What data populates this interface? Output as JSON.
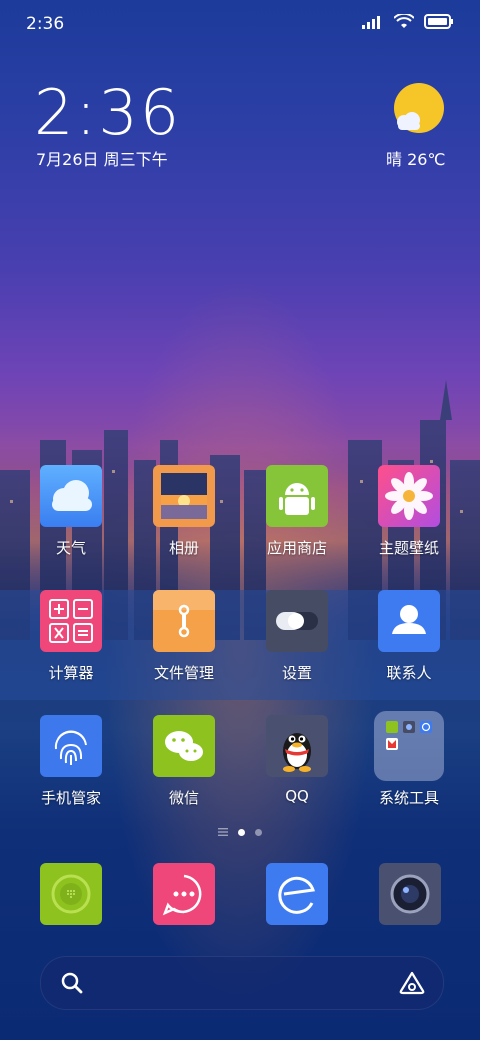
{
  "status_bar": {
    "time": "2:36"
  },
  "clock_widget": {
    "time": "2:36",
    "date": "7月26日 周三下午"
  },
  "weather_widget": {
    "text": "晴 26℃"
  },
  "apps": [
    {
      "label": "天气",
      "icon": "weather-cloud-icon"
    },
    {
      "label": "相册",
      "icon": "gallery-icon"
    },
    {
      "label": "应用商店",
      "icon": "android-store-icon"
    },
    {
      "label": "主题壁纸",
      "icon": "theme-flower-icon"
    },
    {
      "label": "计算器",
      "icon": "calculator-icon"
    },
    {
      "label": "文件管理",
      "icon": "file-manager-icon"
    },
    {
      "label": "设置",
      "icon": "settings-toggle-icon"
    },
    {
      "label": "联系人",
      "icon": "contacts-icon"
    },
    {
      "label": "手机管家",
      "icon": "fingerprint-icon"
    },
    {
      "label": "微信",
      "icon": "wechat-icon"
    },
    {
      "label": "QQ",
      "icon": "qq-penguin-icon"
    },
    {
      "label": "系统工具",
      "icon": "folder-icon"
    }
  ],
  "dock": [
    {
      "icon": "phone-icon"
    },
    {
      "icon": "messages-icon"
    },
    {
      "icon": "browser-icon"
    },
    {
      "icon": "camera-icon"
    }
  ],
  "colors": {
    "accent_sun": "#f6c628",
    "wechat": "#8ec21f",
    "store": "#86c43a"
  }
}
